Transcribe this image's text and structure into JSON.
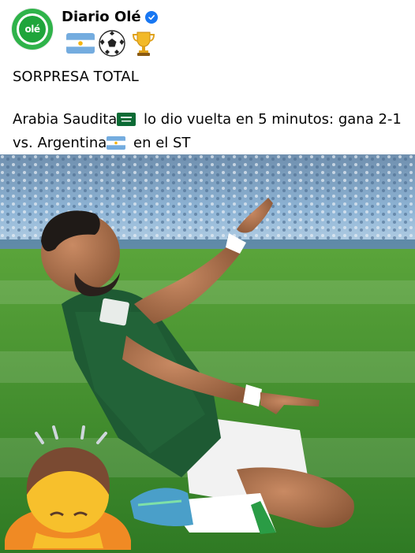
{
  "post": {
    "page_name": "Diario Olé",
    "avatar_text": "olé",
    "header_emojis": [
      "argentina-flag",
      "soccer-ball",
      "trophy"
    ],
    "text_line_1": "SORPRESA TOTAL",
    "text_line_2a": "Arabia Saudita",
    "text_line_2b": " lo dio vuelta en 5 minutos: gana 2-1",
    "text_line_3a": "vs. Argentina",
    "text_line_3b": " en el ST"
  },
  "photo": {
    "subject": "soccer-player-celebrating",
    "overlay_emoji": "person-bowing"
  },
  "colors": {
    "brand_green": "#2fb34a",
    "verified_blue": "#1877f2",
    "jersey_green": "#1e5a33",
    "pitch_green": "#3f8f2c"
  }
}
